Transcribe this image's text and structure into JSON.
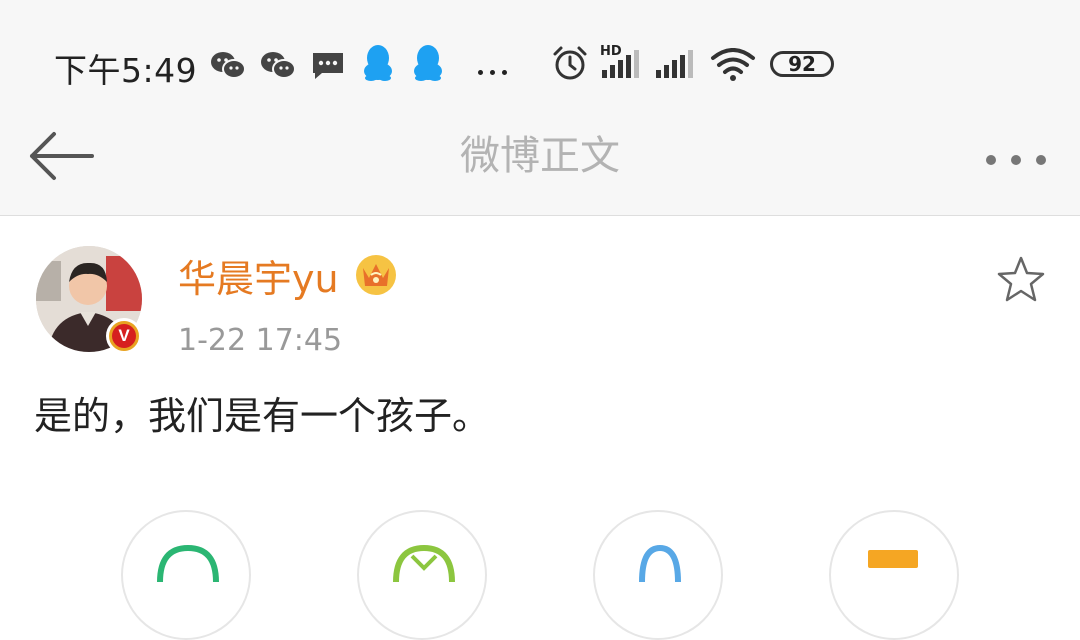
{
  "status_bar": {
    "time": "下午5:49",
    "network_label": "HD",
    "battery": "92",
    "icons": [
      "wechat-icon",
      "wechat-icon",
      "message-icon",
      "qq-icon",
      "qq-icon",
      "more-notifications-icon",
      "alarm-icon",
      "signal-icon",
      "signal-icon",
      "wifi-icon",
      "battery-icon"
    ]
  },
  "nav": {
    "title": "微博正文",
    "back_icon": "arrow-left-icon",
    "more_icon": "more-dots-icon"
  },
  "post": {
    "username": "华晨宇yu",
    "member_icon": "crown-icon",
    "verified_label": "V",
    "date": "1-22 17:45",
    "text": "是的，我们是有一个孩子。",
    "favorite_icon": "star-icon"
  },
  "actions": [
    "share-icon",
    "comment-icon",
    "like-icon",
    "more-icon"
  ],
  "colors": {
    "username": "#e57a22",
    "title": "#b3b3b3",
    "badge": "#d61f1f",
    "action_green": "#2bb673",
    "action_lime": "#8cc63f",
    "action_blue": "#58a8e6",
    "action_orange": "#f5a623"
  }
}
